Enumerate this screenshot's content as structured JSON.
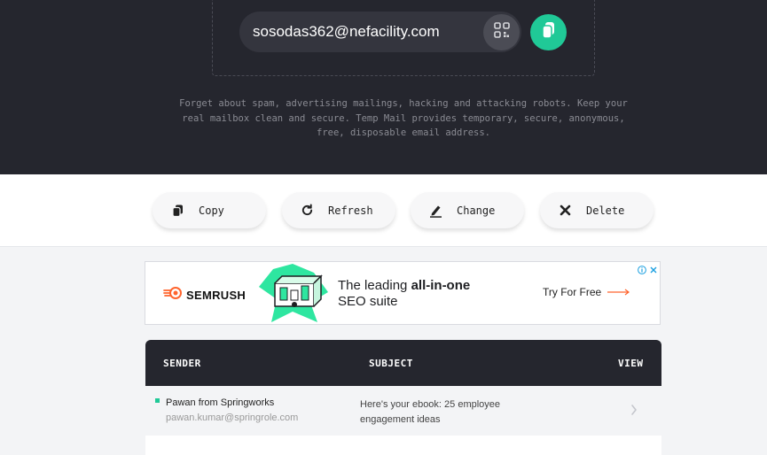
{
  "hero": {
    "email": "sosodas362@nefacility.com",
    "qr_icon": "qr-code-icon",
    "copy_icon": "copy-icon",
    "description": "Forget about spam, advertising mailings, hacking and attacking robots. Keep your real mailbox clean and secure. Temp Mail provides temporary, secure, anonymous, free, disposable email address."
  },
  "actions": [
    {
      "label": "Copy",
      "icon": "copy-icon"
    },
    {
      "label": "Refresh",
      "icon": "refresh-icon"
    },
    {
      "label": "Change",
      "icon": "edit-icon"
    },
    {
      "label": "Delete",
      "icon": "close-icon"
    }
  ],
  "ad": {
    "brand": "SEMRUSH",
    "headline_pre": "The leading ",
    "headline_bold": "all-in-one",
    "headline_post": "SEO suite",
    "cta": "Try For Free",
    "accent": "#ff642d",
    "art_color": "#2ee6a0"
  },
  "inbox": {
    "headers": {
      "sender": "SENDER",
      "subject": "SUBJECT",
      "view": "VIEW"
    },
    "messages": [
      {
        "sender_name": "Pawan from Springworks",
        "sender_email": "pawan.kumar@springrole.com",
        "subject": "Here's your ebook: 25 employee engagement ideas",
        "unread": true
      }
    ]
  },
  "colors": {
    "dark": "#25262e",
    "accent": "#20c997"
  }
}
